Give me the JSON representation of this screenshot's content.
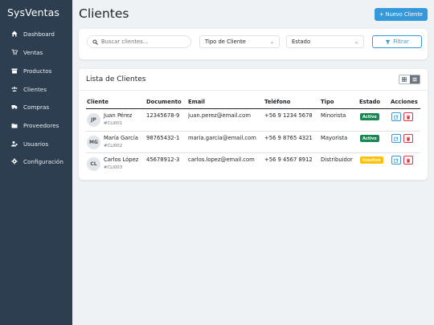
{
  "sidebar": {
    "brand": "SysVentas",
    "items": [
      {
        "label": "Dashboard",
        "icon": "home-icon"
      },
      {
        "label": "Ventas",
        "icon": "cart-icon"
      },
      {
        "label": "Productos",
        "icon": "box-icon"
      },
      {
        "label": "Clientes",
        "icon": "users-icon"
      },
      {
        "label": "Compras",
        "icon": "truck-icon"
      },
      {
        "label": "Proveedores",
        "icon": "building-icon"
      },
      {
        "label": "Usuarios",
        "icon": "user-gear-icon"
      },
      {
        "label": "Configuración",
        "icon": "gear-icon"
      }
    ]
  },
  "header": {
    "title": "Clientes",
    "new_button": "+ Nuevo Cliente"
  },
  "filters": {
    "search_placeholder": "Buscar clientes...",
    "tipo": "Tipo de Cliente",
    "estado": "Estado",
    "filter_button": "Filtrar"
  },
  "list": {
    "title": "Lista de Clientes",
    "columns": [
      "Cliente",
      "Documento",
      "Email",
      "Teléfono",
      "Tipo",
      "Estado",
      "Acciones"
    ],
    "rows": [
      {
        "initials": "JP",
        "name": "Juan Pérez",
        "code": "#CLI001",
        "doc": "12345678-9",
        "email": "juan.perez@email.com",
        "phone": "+56 9 1234 5678",
        "tipo": "Minorista",
        "estado": "Activo",
        "estado_color": "#198754"
      },
      {
        "initials": "MG",
        "name": "María García",
        "code": "#CLI002",
        "doc": "98765432-1",
        "email": "maria.garcia@email.com",
        "phone": "+56 9 8765 4321",
        "tipo": "Mayorista",
        "estado": "Activo",
        "estado_color": "#198754"
      },
      {
        "initials": "CL",
        "name": "Carlos López",
        "code": "#CLI003",
        "doc": "45678912-3",
        "email": "carlos.lopez@email.com",
        "phone": "+56 9 4567 8912",
        "tipo": "Distribuidor",
        "estado": "Inactivo",
        "estado_color": "#ffc107"
      }
    ]
  },
  "colors": {
    "sidebar_bg": "#2c3e50",
    "primary": "#3498db",
    "danger": "#dc3545"
  }
}
